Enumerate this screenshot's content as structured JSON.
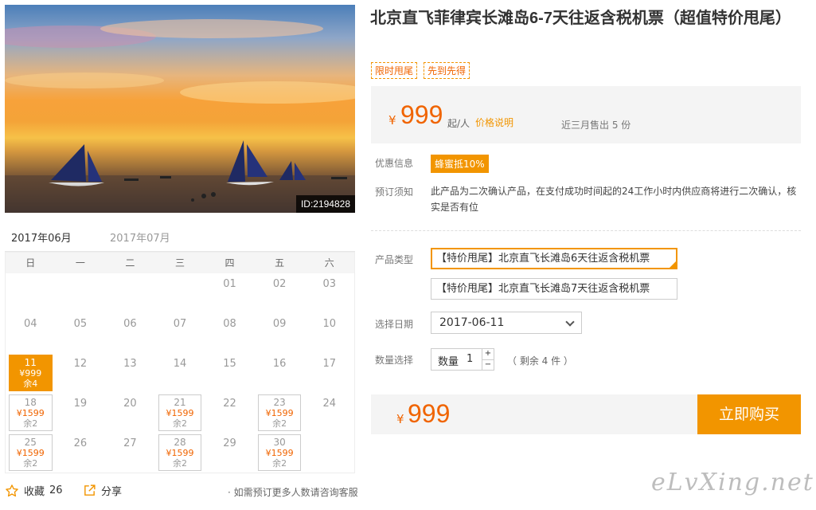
{
  "product": {
    "title": "北京直飞菲律宾长滩岛6-7天往返含税机票（超值特价甩尾）",
    "tags": [
      "限时甩尾",
      "先到先得"
    ],
    "image_id": "ID:2194828"
  },
  "price": {
    "currency": "¥",
    "amount": "999",
    "per": "起/人",
    "explain": "价格说明",
    "sold": "近三月售出 5 份"
  },
  "promo": {
    "label": "优惠信息",
    "badge": "蜂蜜抵10%"
  },
  "notice": {
    "label": "预订须知",
    "text": "此产品为二次确认产品，在支付成功时间起的24工作小时内供应商将进行二次确认，核实是否有位"
  },
  "product_type": {
    "label": "产品类型",
    "options": [
      "【特价甩尾】北京直飞长滩岛6天往返含税机票",
      "【特价甩尾】北京直飞长滩岛7天往返含税机票"
    ]
  },
  "date": {
    "label": "选择日期",
    "value": "2017-06-11"
  },
  "quantity": {
    "label": "数量选择",
    "field_label": "数量",
    "value": "1",
    "plus": "+",
    "minus": "−",
    "remain": "（ 剩余 4 件 ）"
  },
  "total": {
    "currency": "¥",
    "amount": "999",
    "buy_label": "立即购买"
  },
  "calendar": {
    "tabs": [
      "2017年06月",
      "2017年07月"
    ],
    "weekdays": [
      "日",
      "一",
      "二",
      "三",
      "四",
      "五",
      "六"
    ],
    "days": [
      {
        "d": ""
      },
      {
        "d": ""
      },
      {
        "d": ""
      },
      {
        "d": ""
      },
      {
        "d": "01"
      },
      {
        "d": "02"
      },
      {
        "d": "03"
      },
      {
        "d": "04"
      },
      {
        "d": "05"
      },
      {
        "d": "06"
      },
      {
        "d": "07"
      },
      {
        "d": "08"
      },
      {
        "d": "09"
      },
      {
        "d": "10"
      },
      {
        "d": "11",
        "price": "¥999",
        "remain": "余4",
        "selected": true
      },
      {
        "d": "12"
      },
      {
        "d": "13"
      },
      {
        "d": "14"
      },
      {
        "d": "15"
      },
      {
        "d": "16"
      },
      {
        "d": "17"
      },
      {
        "d": "18",
        "price": "¥1599",
        "remain": "余2"
      },
      {
        "d": "19"
      },
      {
        "d": "20"
      },
      {
        "d": "21",
        "price": "¥1599",
        "remain": "余2"
      },
      {
        "d": "22"
      },
      {
        "d": "23",
        "price": "¥1599",
        "remain": "余2"
      },
      {
        "d": "24"
      },
      {
        "d": "25",
        "price": "¥1599",
        "remain": "余2"
      },
      {
        "d": "26"
      },
      {
        "d": "27"
      },
      {
        "d": "28",
        "price": "¥1599",
        "remain": "余2"
      },
      {
        "d": "29"
      },
      {
        "d": "30",
        "price": "¥1599",
        "remain": "余2"
      },
      {
        "d": ""
      }
    ]
  },
  "footer": {
    "favorite_label": "收藏",
    "favorite_count": "26",
    "share_label": "分享",
    "consult": "· 如需预订更多人数请咨询客服"
  },
  "watermark": "eLvXing.net",
  "colors": {
    "accent": "#f29500",
    "price": "#f06400"
  },
  "icons": {
    "favorite": "star-outline-icon",
    "share": "share-arrow-icon",
    "date_select": "chevron-down-icon"
  }
}
